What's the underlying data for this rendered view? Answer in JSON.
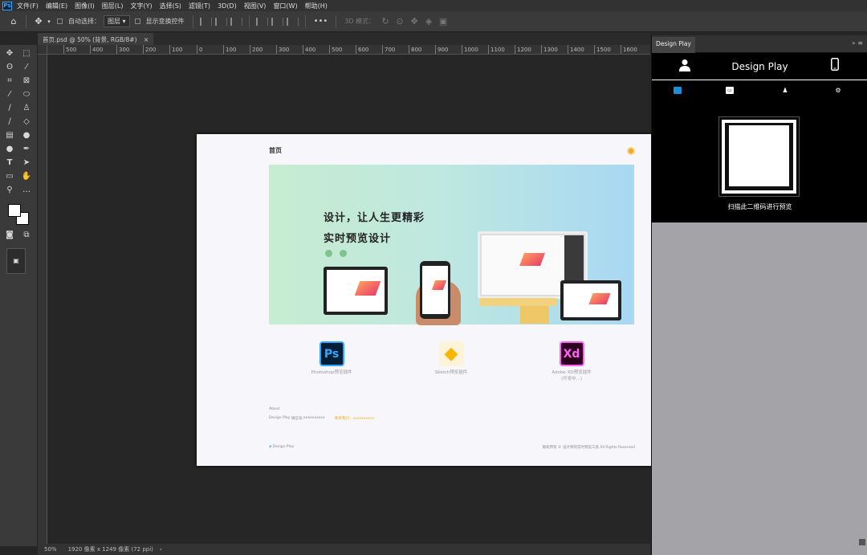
{
  "menubar": {
    "app_logo": "Ps",
    "items": [
      "文件(F)",
      "编辑(E)",
      "图像(I)",
      "图层(L)",
      "文字(Y)",
      "选择(S)",
      "滤镜(T)",
      "3D(D)",
      "视图(V)",
      "窗口(W)",
      "帮助(H)"
    ]
  },
  "options": {
    "home_icon": "home-icon",
    "move_icon": "move-icon",
    "auto_select_label": "自动选择：",
    "auto_select_value": "图层",
    "show_transform_label": "显示变换控件",
    "more": "•••",
    "mode_3d_label": "3D 模式："
  },
  "document_tab": {
    "label": "首页.psd @ 50% (背景, RGB/8#)",
    "close": "×"
  },
  "ruler": {
    "ticks": [
      "500",
      "400",
      "300",
      "200",
      "100",
      "0",
      "100",
      "200",
      "300",
      "400",
      "500",
      "600",
      "700",
      "800",
      "900",
      "1000",
      "1100",
      "1200",
      "1300",
      "1400",
      "1500",
      "1600"
    ]
  },
  "status": {
    "zoom": "50%",
    "info": "1920 像素 x 1249 像素 (72 ppi)",
    "arrow": "›"
  },
  "doc": {
    "title": "首页",
    "headline1": "设计，让人生更精彩",
    "headline2": "实时预览设计",
    "plugins": [
      {
        "icon_text": "Ps",
        "label": "Photoshop预览插件",
        "bg": "#001e36",
        "fg": "#31a8ff"
      },
      {
        "icon_text": "◆",
        "label": "Sketch预览插件",
        "bg": "#fdf3d8",
        "fg": "#f7b500"
      },
      {
        "icon_text": "Xd",
        "label": "Adobe XD预览插件",
        "label2": "(开发中...)",
        "bg": "#2e001f",
        "fg": "#ff61f6"
      }
    ],
    "footer": {
      "about": "About",
      "product": "Design Play",
      "contact": "微信号：",
      "contact_value": "xxxxxxxxxx",
      "highlight": "联系我们：xxxxxxxxxx",
      "brand": "Design Play",
      "copyright": "版权所有 © 设计师的实时预览工具 All Rights Reserved"
    }
  },
  "panel": {
    "tab": "Design Play",
    "controls": "»  ≡",
    "title": "Design Play",
    "caption": "扫描此二维码进行预览"
  },
  "colors": {
    "accent": "#31a8ff",
    "orange": "#f5a623"
  }
}
